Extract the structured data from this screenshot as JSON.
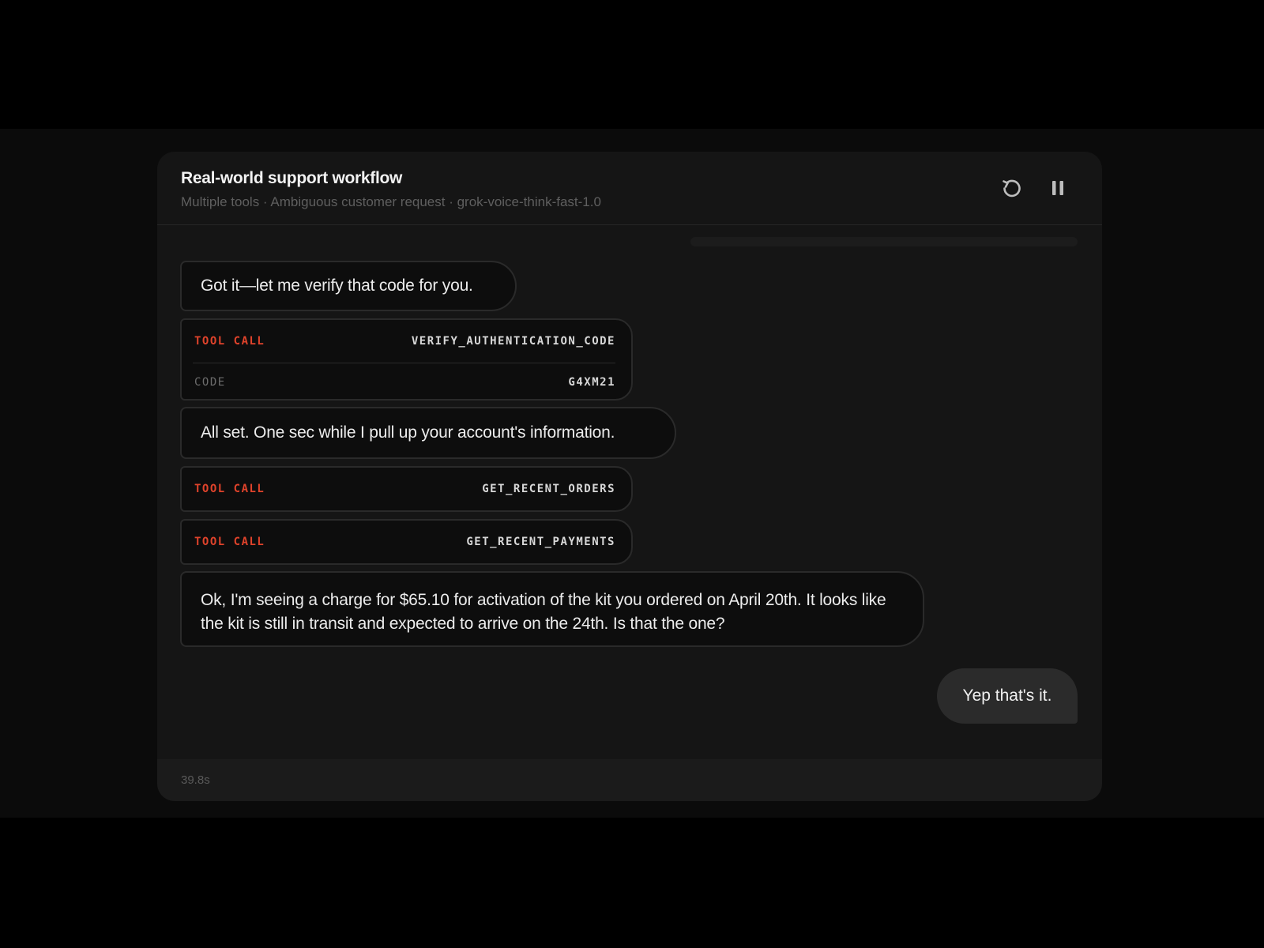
{
  "header": {
    "title": "Real-world support workflow",
    "subtitle": "Multiple tools · Ambiguous customer request · grok-voice-think-fast-1.0",
    "restart_icon": "restart-icon",
    "pause_icon": "pause-icon"
  },
  "messages": {
    "agent_1": "Got it—let me verify that code for you.",
    "tool_1": {
      "label": "TOOL CALL",
      "name": "VERIFY_AUTHENTICATION_CODE",
      "param_key": "CODE",
      "param_value": "G4XM21"
    },
    "agent_2": "All set. One sec while I pull up your account's information.",
    "tool_2": {
      "label": "TOOL CALL",
      "name": "GET_RECENT_ORDERS"
    },
    "tool_3": {
      "label": "TOOL CALL",
      "name": "GET_RECENT_PAYMENTS"
    },
    "agent_3": "Ok, I'm seeing a charge for $65.10 for activation of the kit you ordered on April 20th. It looks like the kit is still in transit and expected to arrive on the 24th. Is that the one?",
    "user_1": "Yep that's it."
  },
  "footer": {
    "timer": "39.8s"
  },
  "colors": {
    "tool_label": "#e0432b",
    "panel_bg": "#151515",
    "user_bubble": "#2b2b2b"
  }
}
